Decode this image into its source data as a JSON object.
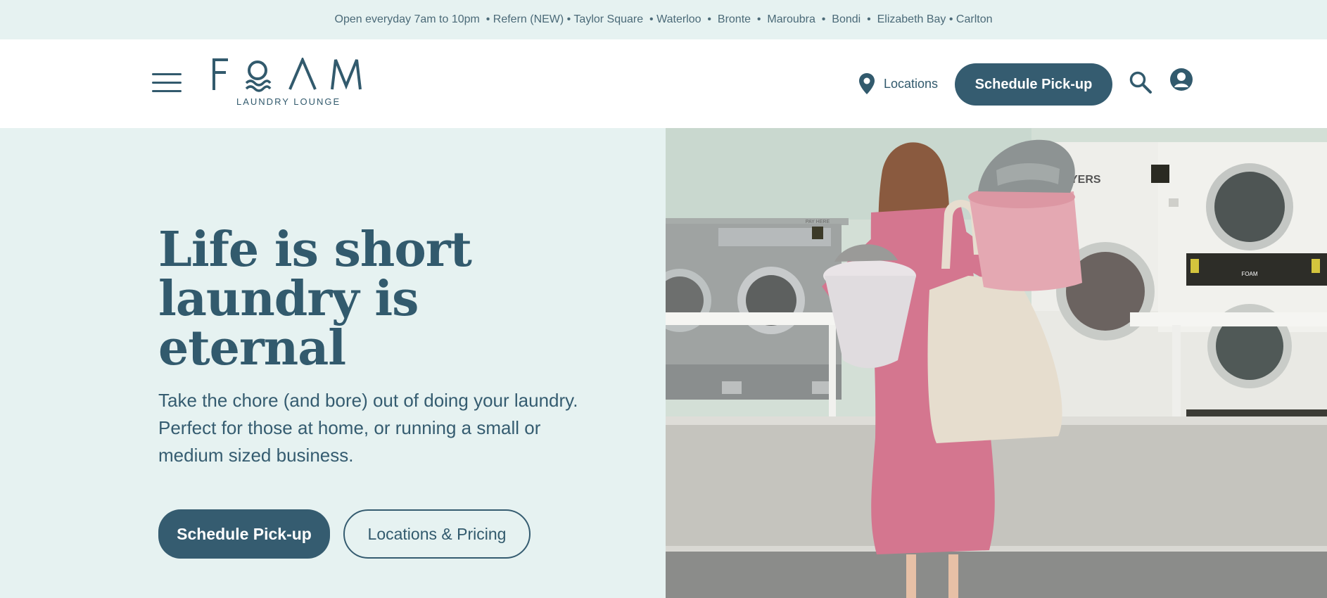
{
  "announcement": {
    "text": "Open everyday 7am to 10pm  • Refern (NEW) • Taylor Square  • Waterloo  •  Bronte  •  Maroubra  •  Bondi  •  Elizabeth Bay • Carlton"
  },
  "header": {
    "logo_word": "FOAM",
    "logo_tagline": "LAUNDRY LOUNGE",
    "locations_label": "Locations",
    "schedule_label": "Schedule Pick-up",
    "icons": [
      "menu-icon",
      "location-pin-icon",
      "search-icon",
      "account-icon"
    ]
  },
  "hero": {
    "title": "Life is short\nlaundry is\neternal",
    "subtitle": "Take the chore (and bore) out of doing your laundry. Perfect for those at home, or running a small or medium sized business.",
    "primary_cta": "Schedule Pick-up",
    "secondary_cta": "Locations & Pricing",
    "image_text": {
      "pay_here": "PAY HERE",
      "dryers_sign": "YERS",
      "machine_brand": "FOAM"
    }
  },
  "colors": {
    "brand": "#355c70",
    "bg_tint": "#e6f2f1",
    "white": "#ffffff",
    "dress": "#d4768f"
  }
}
